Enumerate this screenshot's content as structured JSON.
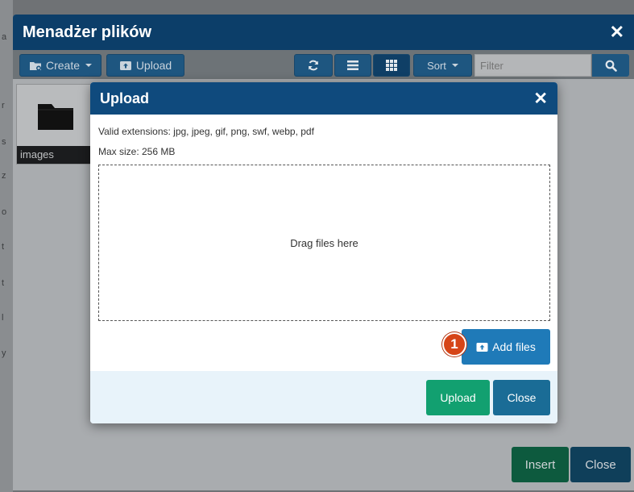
{
  "background": {
    "letters": [
      "a",
      "r",
      "s",
      "z",
      "o",
      "t",
      "t",
      "l",
      "y"
    ]
  },
  "file_manager": {
    "title": "Menadżer plików",
    "toolbar": {
      "create_label": "Create",
      "upload_label": "Upload",
      "sort_label": "Sort",
      "filter_placeholder": "Filter"
    },
    "files": [
      {
        "name": "images",
        "icon": "folder-icon"
      }
    ],
    "footer": {
      "insert_label": "Insert",
      "close_label": "Close"
    }
  },
  "upload_modal": {
    "title": "Upload",
    "valid_extensions": "Valid extensions: jpg, jpeg, gif, png, swf, webp, pdf",
    "max_size": "Max size: 256 MB",
    "dropzone_text": "Drag files here",
    "add_files_label": "Add files",
    "step_badge": "1",
    "upload_label": "Upload",
    "close_label": "Close"
  },
  "colors": {
    "header": "#0c3e69",
    "modal_header": "#0f4a7d",
    "upload_green": "#12a070",
    "close_blue": "#1a6c96",
    "add_files_blue": "#1f7ab8",
    "badge_red": "#d64518"
  }
}
